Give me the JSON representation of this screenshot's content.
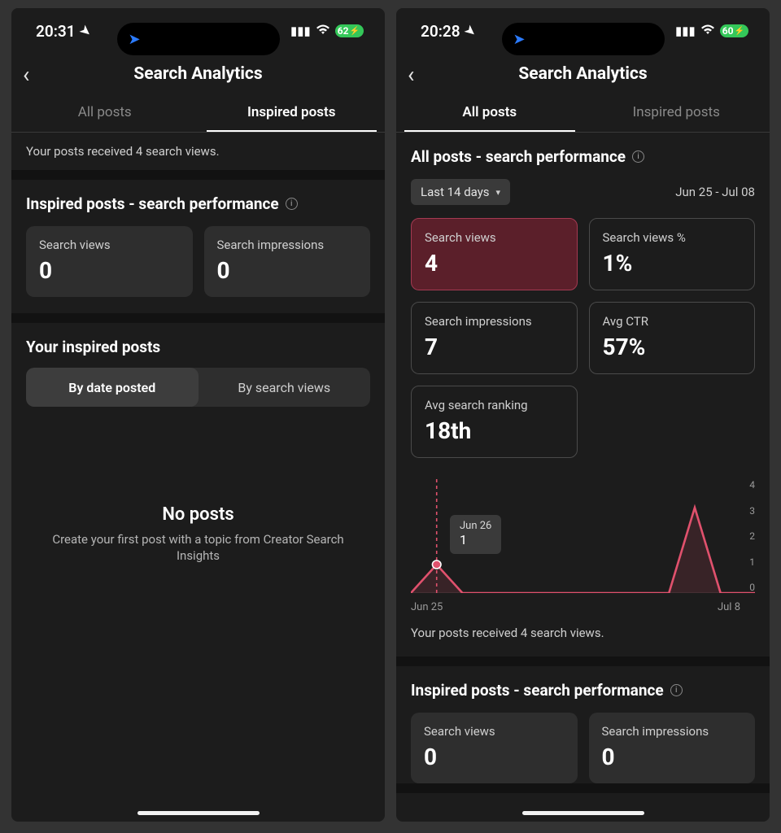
{
  "left": {
    "status": {
      "time": "20:31",
      "battery": "62"
    },
    "title": "Search Analytics",
    "tabs": {
      "all": "All posts",
      "inspired": "Inspired posts",
      "active": "inspired"
    },
    "summary": "Your posts received 4 search views.",
    "perf_title": "Inspired posts - search performance",
    "metrics": [
      {
        "label": "Search views",
        "value": "0"
      },
      {
        "label": "Search impressions",
        "value": "0"
      }
    ],
    "your_posts_title": "Your inspired posts",
    "sort": {
      "by_date": "By date posted",
      "by_views": "By search views",
      "active": "by_date"
    },
    "empty": {
      "title": "No posts",
      "sub": "Create your first post with a topic from Creator Search Insights"
    }
  },
  "right": {
    "status": {
      "time": "20:28",
      "battery": "60"
    },
    "title": "Search Analytics",
    "tabs": {
      "all": "All posts",
      "inspired": "Inspired posts",
      "active": "all"
    },
    "all_perf_title": "All posts - search performance",
    "dropdown_label": "Last 14 days",
    "date_range": "Jun 25 - Jul 08",
    "metrics": [
      {
        "label": "Search views",
        "value": "4",
        "selected": true
      },
      {
        "label": "Search views %",
        "value": "1%"
      },
      {
        "label": "Search impressions",
        "value": "7"
      },
      {
        "label": "Avg CTR",
        "value": "57%"
      },
      {
        "label": "Avg search ranking",
        "value": "18th"
      }
    ],
    "chart": {
      "tooltip_date": "Jun 26",
      "tooltip_value": "1",
      "x_start": "Jun 25",
      "x_end": "Jul 8",
      "y_ticks": [
        "4",
        "3",
        "2",
        "1",
        "0"
      ]
    },
    "summary": "Your posts received 4 search views.",
    "inspired_perf_title": "Inspired posts - search performance",
    "inspired_metrics": [
      {
        "label": "Search views",
        "value": "0"
      },
      {
        "label": "Search impressions",
        "value": "0"
      }
    ]
  },
  "chart_data": {
    "type": "line",
    "title": "Search views",
    "xlabel": "",
    "ylabel": "",
    "ylim": [
      0,
      4
    ],
    "x": [
      "Jun 25",
      "Jun 26",
      "Jun 27",
      "Jun 28",
      "Jun 29",
      "Jun 30",
      "Jul 1",
      "Jul 2",
      "Jul 3",
      "Jul 4",
      "Jul 5",
      "Jul 6",
      "Jul 7",
      "Jul 8"
    ],
    "series": [
      {
        "name": "Search views",
        "values": [
          0,
          1,
          0,
          0,
          0,
          0,
          0,
          0,
          0,
          0,
          0,
          3,
          0,
          0
        ]
      }
    ],
    "highlight": {
      "x": "Jun 26",
      "value": 1
    }
  }
}
